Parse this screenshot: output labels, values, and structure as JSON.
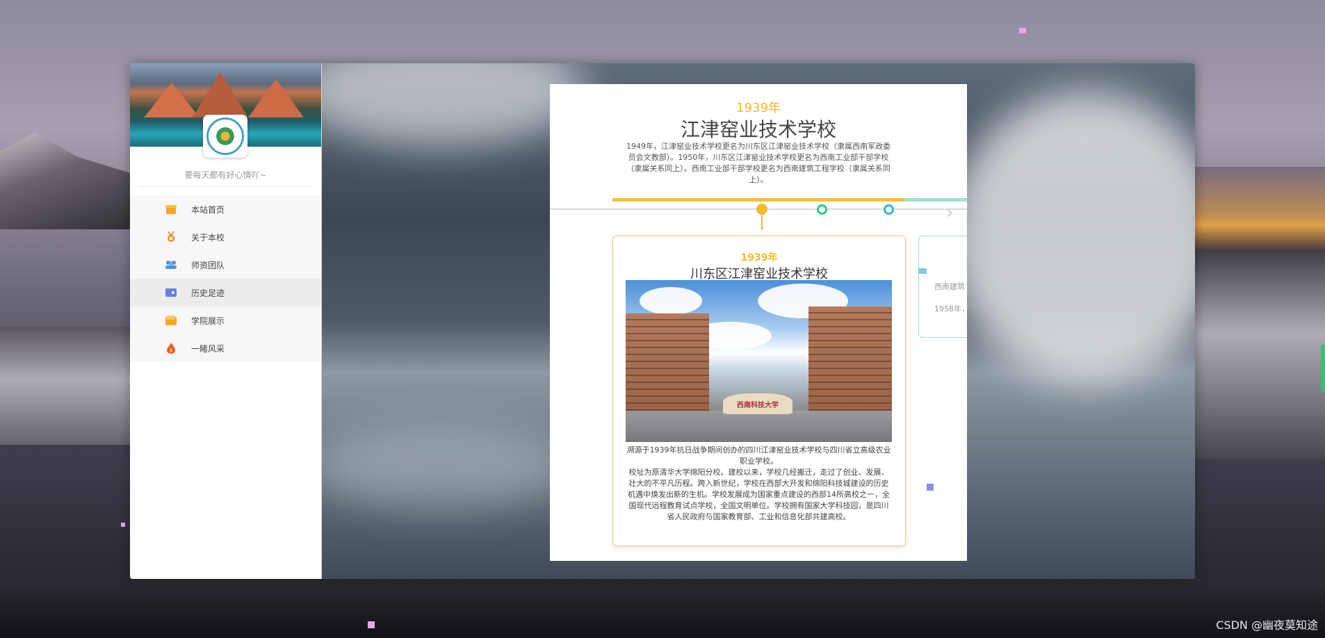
{
  "sidebar": {
    "motto": "要每天都有好心情吖~",
    "items": [
      {
        "label": "本站首页",
        "icon": "gift-icon",
        "color": "#f5a623"
      },
      {
        "label": "关于本校",
        "icon": "medal-icon",
        "color": "#f08c2e"
      },
      {
        "label": "师资团队",
        "icon": "team-icon",
        "color": "#4a90e2"
      },
      {
        "label": "历史足迹",
        "icon": "wallet-icon",
        "color": "#6b7be8"
      },
      {
        "label": "学院展示",
        "icon": "folder-icon",
        "color": "#f5a623"
      },
      {
        "label": "一睹风采",
        "icon": "flame-icon",
        "color": "#f05a28"
      }
    ],
    "active_index": 3
  },
  "timeline": {
    "header_year": "1939年",
    "header_title": "江津窑业技术学校",
    "header_desc": "1949年，江津窑业技术学校更名为川东区江津窑业技术学校（隶属西南军政委员会文教部）。1950年，川东区江津窑业技术学校更名为西南工业部干部学校（隶属关系同上）。西南工业部干部学校更名为西南建筑工程学校（隶属关系同上）。",
    "next_arrow": "›",
    "card": {
      "year": "1939年",
      "title": "川东区江津窑业技术学校",
      "photo_caption": "西南科技大学",
      "desc1": "溯源于1939年抗日战争期间创办的四川江津窑业技术学校与四川省立高级农业职业学校。",
      "desc2": "校址为原清华大学绵阳分校。建校以来，学校几经搬迁，走过了创业、发展、壮大的不平凡历程。跨入新世纪，学校在西部大开发和绵阳科技城建设的历史机遇中焕发出新的生机。学校发展成为国家重点建设的西部14所高校之一，全国现代远程教育试点学校，全国文明单位。学校拥有国家大学科技园，是四川省人民政府与国家教育部、工业和信息化部共建高校。"
    },
    "next_card": {
      "text1": "西南建筑",
      "text2": "1958年，"
    }
  },
  "watermark": "CSDN @幽夜莫知途",
  "colors": {
    "accent": "#f5b82e",
    "green": "#2ec985",
    "cyan": "#30b8d0"
  }
}
